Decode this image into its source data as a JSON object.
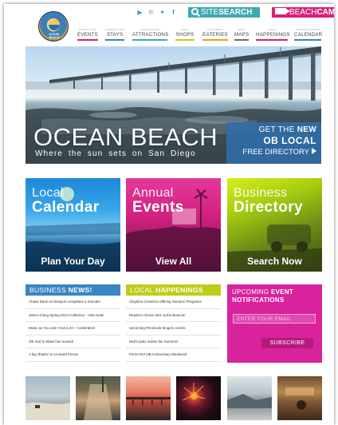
{
  "header": {
    "logo_text": "OCEAN BEACH",
    "social_icons": [
      "youtube-icon",
      "pinterest-icon",
      "twitter-icon",
      "facebook-icon"
    ],
    "site_search": {
      "prefix": "SITE",
      "emphasis": "SEARCH"
    },
    "beach_cam": {
      "prefix": "BEACH",
      "emphasis": "CAM"
    }
  },
  "nav": [
    {
      "sub": "THINGS TO DO",
      "label": "EVENTS",
      "color": "#d6237b"
    },
    {
      "sub": "WHERE TO STAY",
      "label": "STAYS",
      "color": "#3a86c4"
    },
    {
      "sub": "THINGS TO SEE",
      "label": "ATTRACTIONS",
      "color": "#3eaab3"
    },
    {
      "sub": "LOCAL",
      "label": "SHOPS",
      "color": "#bfcc18"
    },
    {
      "sub": "EAT & DRINK",
      "label": "EATERIES",
      "color": "#e8a21a"
    },
    {
      "sub": "MAPS",
      "label": "MAPS",
      "color": "#6d6d6d"
    },
    {
      "sub": "LOCAL",
      "label": "HAPPENINGS",
      "color": "#d6237b"
    },
    {
      "sub": "UPCOMING EVENTS",
      "label": "CALENDAR",
      "color": "#3a86c4"
    }
  ],
  "hero": {
    "title": "OCEAN BEACH",
    "tagline": "Where the sun sets on San Diego",
    "promo": {
      "line1_pre": "GET THE",
      "line1_bold": "NEW",
      "line2": "OB LOCAL",
      "line3": "FREE DIRECTORY"
    }
  },
  "tiles": [
    {
      "line1": "Local",
      "line2": "Calendar",
      "cta": "Plan Your Day"
    },
    {
      "line1": "Annual",
      "line2": "Events",
      "cta": "View All"
    },
    {
      "line1": "Business",
      "line2": "Directory",
      "cta": "Search Now"
    }
  ],
  "business_news": {
    "title_pre": "BUSINESS",
    "title_bold": "NEWS!",
    "items": [
      "Chase Bank on Newport completes a remodel",
      "James Gang Spring 2013 Collection - Vote Now!",
      "Music as You Like It turns 40 + Celebrates!",
      "OB Surf & Skate has moved!",
      "A big 'thanks' to Leonard Porras"
    ]
  },
  "local_happenings": {
    "title_pre": "LOCAL",
    "title_bold": "HAPPENINGS",
    "items": [
      "Claytime Ceramics offering Summer Programs",
      "Readers Choice time at the Beacon!",
      "Upcoming Peninsula Singers events",
      "Nati's patio invites the Summer!",
      "Pizza Port OB Anniversary Weekend!"
    ]
  },
  "notifications": {
    "line1_pre": "UPCOMING",
    "line1_bold": "EVENT",
    "line2": "NOTIFICATIONS",
    "email_placeholder": "ENTER YOUR EMAIL",
    "subscribe_label": "SUBSCRIBE"
  }
}
